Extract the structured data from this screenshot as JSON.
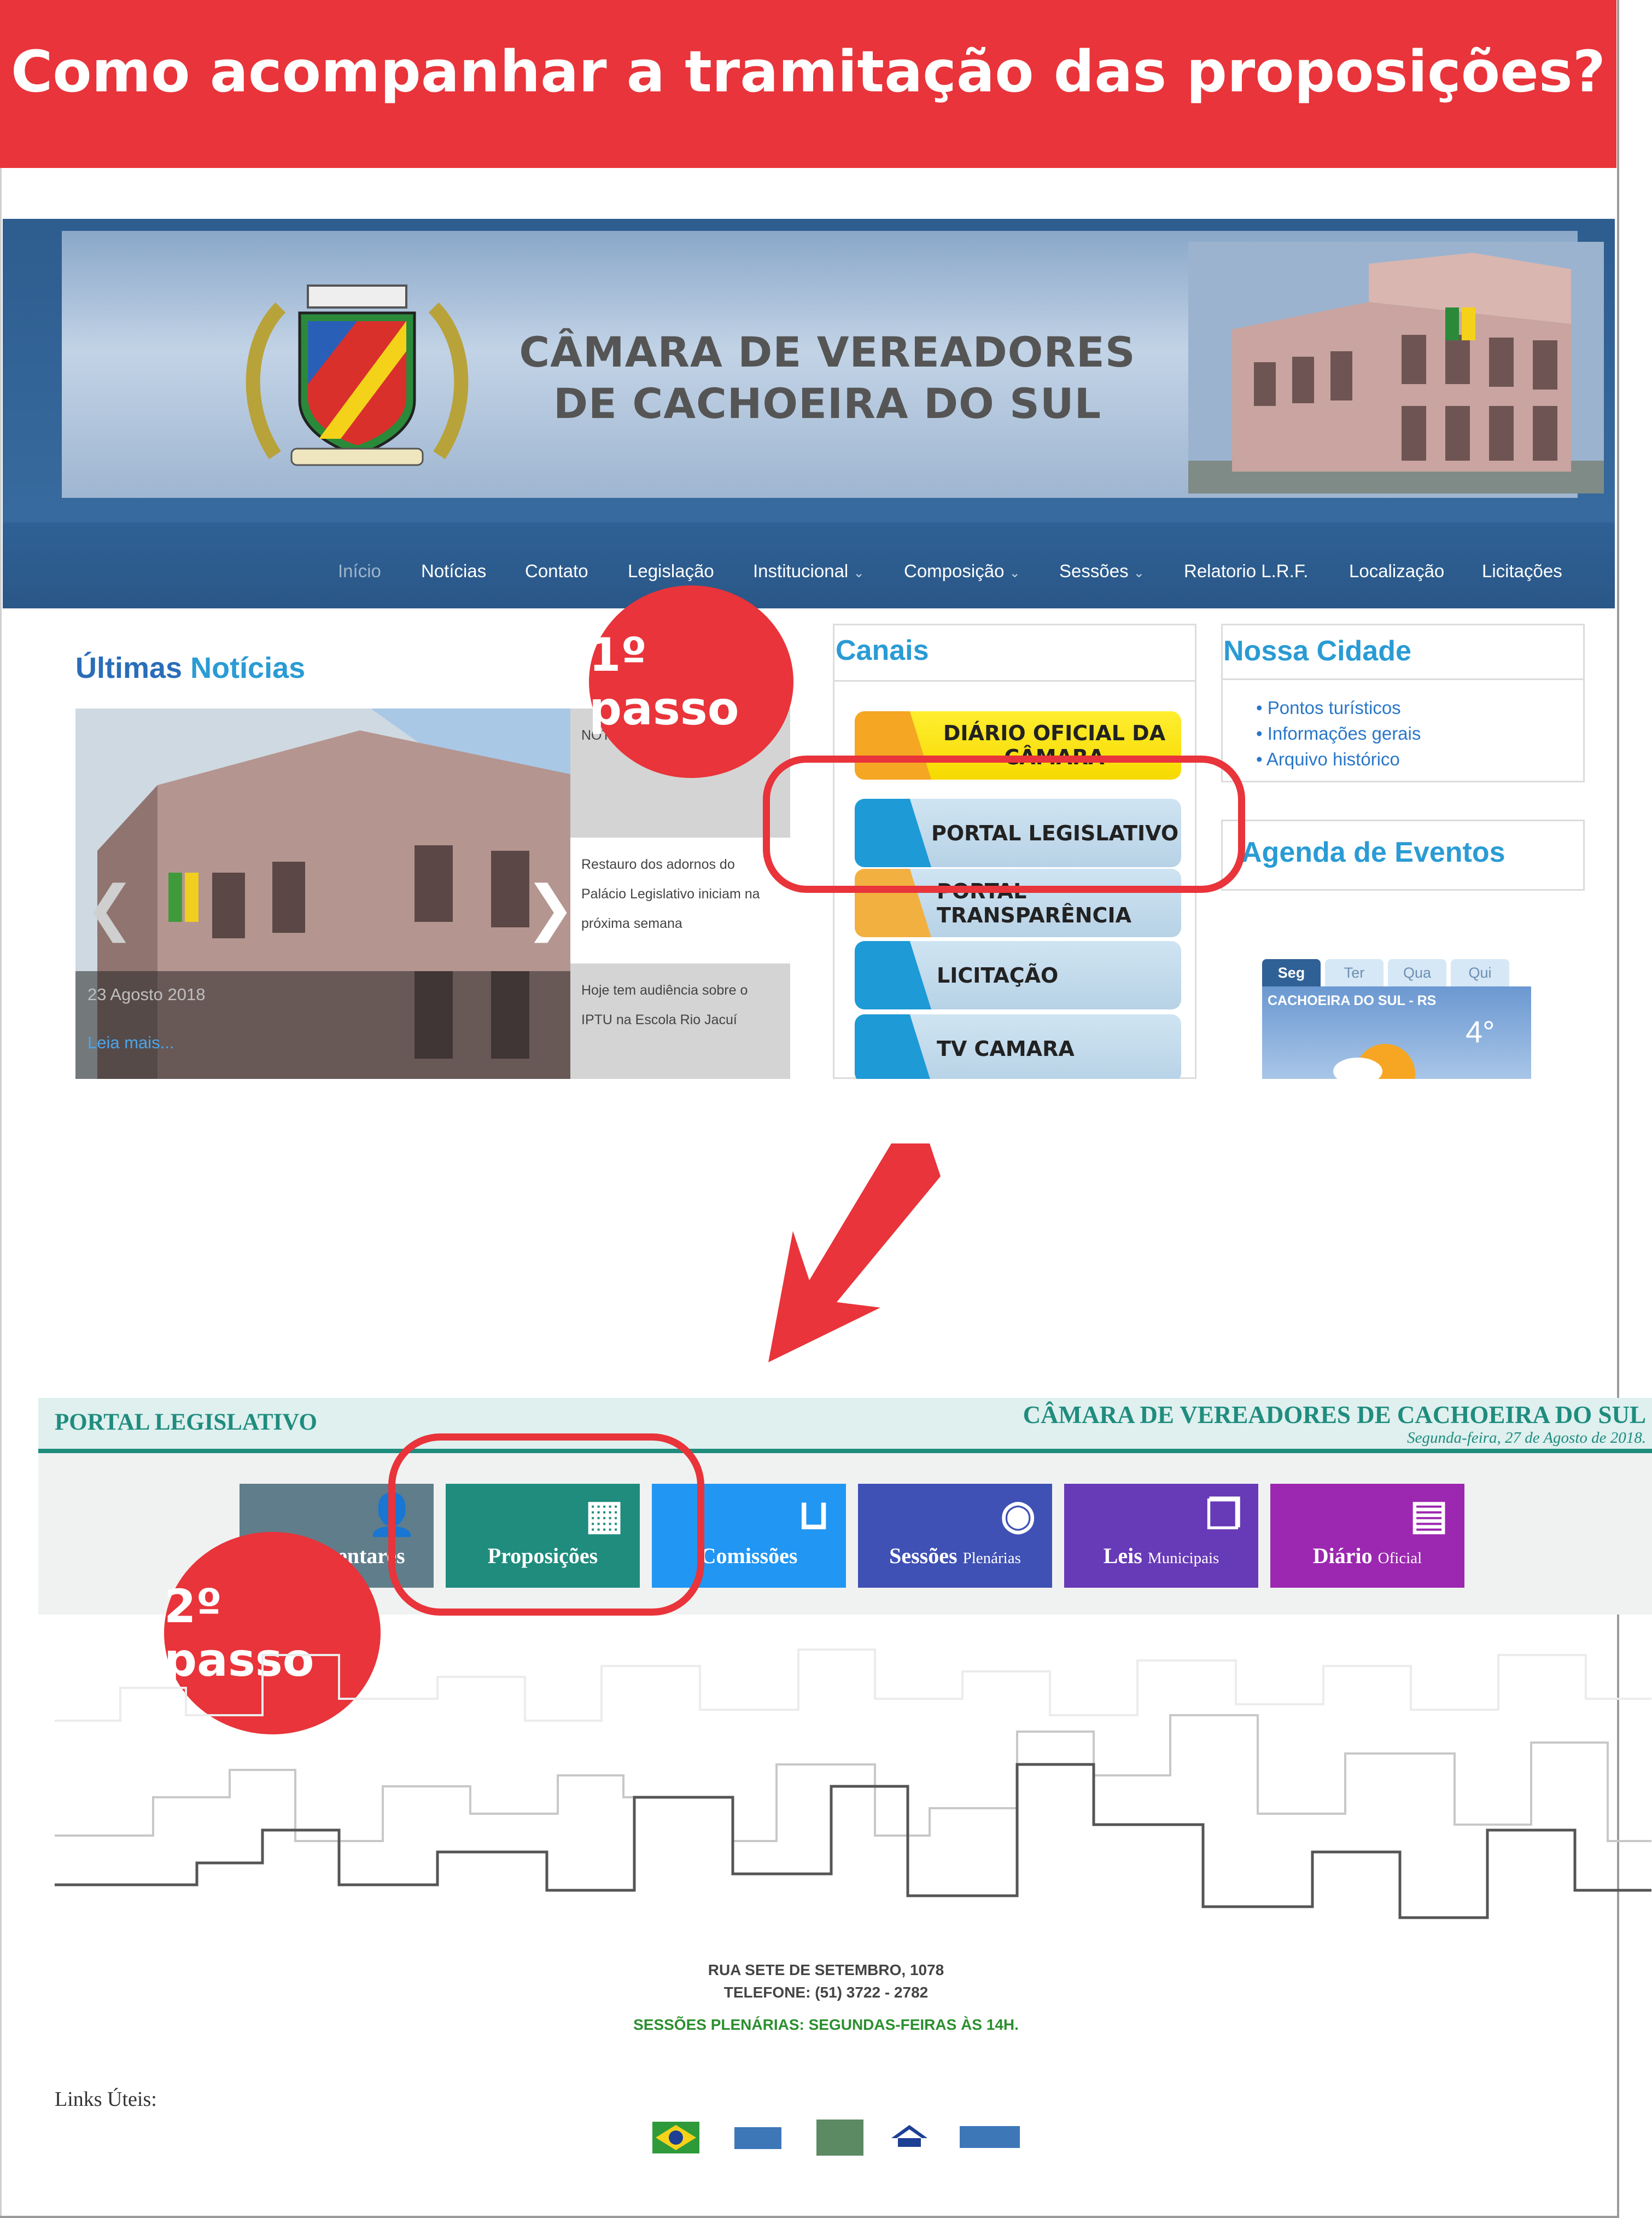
{
  "title": "Como acompanhar a tramitação das proposições?",
  "site": {
    "banner_title_line1": "CÂMARA DE VEREADORES",
    "banner_title_line2": "DE CACHOEIRA DO SUL",
    "nav": [
      {
        "label": "Início",
        "caret": false
      },
      {
        "label": "Notícias",
        "caret": false
      },
      {
        "label": "Contato",
        "caret": false
      },
      {
        "label": "Legislação",
        "caret": false
      },
      {
        "label": "Institucional",
        "caret": true
      },
      {
        "label": "Composição",
        "caret": true
      },
      {
        "label": "Sessões",
        "caret": true
      },
      {
        "label": "Relatorio L.R.F.",
        "caret": false
      },
      {
        "label": "Localização",
        "caret": false
      },
      {
        "label": "Licitações",
        "caret": false
      }
    ],
    "news": {
      "heading_a": "Últimas",
      "heading_b": "Notícias",
      "date": "23 Agosto 2018",
      "read_more": "Leia mais...",
      "items": [
        "NOTA DE ESCLARECIMENTO",
        "Restauro dos adornos do Palácio Legislativo iniciam na próxima semana",
        "Hoje tem audiência sobre o IPTU na Escola Rio Jacuí"
      ]
    },
    "canais": {
      "title": "Canais",
      "items": [
        {
          "label": "DIÁRIO OFICIAL DA CÂMARA",
          "icon": "newspaper-icon"
        },
        {
          "label": "PORTAL LEGISLATIVO",
          "icon": "document-icon"
        },
        {
          "label": "PORTAL TRANSPARÊNCIA",
          "icon": "chart-icon"
        },
        {
          "label": "LICITAÇÃO",
          "icon": "gavel-icon"
        },
        {
          "label": "TV CAMARA",
          "icon": "tv-icon"
        }
      ]
    },
    "cidade": {
      "title": "Nossa Cidade",
      "links": [
        "Pontos turísticos",
        "Informações gerais",
        "Arquivo histórico"
      ]
    },
    "agenda_title": "Agenda de Eventos",
    "weather": {
      "days": [
        "Seg",
        "Ter",
        "Qua",
        "Qui"
      ],
      "city": "CACHOEIRA DO SUL - RS",
      "temp": "4°"
    },
    "arrows": {
      "prev": "❮",
      "next": "❯"
    }
  },
  "steps": {
    "one": "1º passo",
    "two": "2º passo"
  },
  "portal": {
    "title": "PORTAL LEGISLATIVO",
    "org": "CÂMARA DE VEREADORES DE CACHOEIRA DO SUL",
    "date": "Segunda-feira, 27 de Agosto de 2018.",
    "tiles": [
      {
        "label": "Parlamentares",
        "sub": "",
        "icon": "person-icon",
        "color": "#607d8b"
      },
      {
        "label": "Proposições",
        "sub": "",
        "icon": "qr-code-icon",
        "color": "#1f8c7e"
      },
      {
        "label": "Comissões",
        "sub": "",
        "icon": "inbox-icon",
        "color": "#2196f3"
      },
      {
        "label": "Sessões",
        "sub": "Plenárias",
        "icon": "eye-icon",
        "color": "#3f51b5"
      },
      {
        "label": "Leis",
        "sub": "Municipais",
        "icon": "files-icon",
        "color": "#673ab7"
      },
      {
        "label": "Diário",
        "sub": "Oficial",
        "icon": "calendar-icon",
        "color": "#9c27b0"
      }
    ],
    "address": "RUA SETE DE SETEMBRO, 1078",
    "phone": "TELEFONE: (51) 3722 - 2782",
    "sessions": "SESSÕES PLENÁRIAS: SEGUNDAS-FEIRAS ÀS 14H.",
    "links_label": "Links Úteis:",
    "link_logos": [
      "brazil-flag-icon",
      "senado-icon",
      "diario-icon",
      "receita-federal-icon",
      "stf-icon"
    ]
  }
}
